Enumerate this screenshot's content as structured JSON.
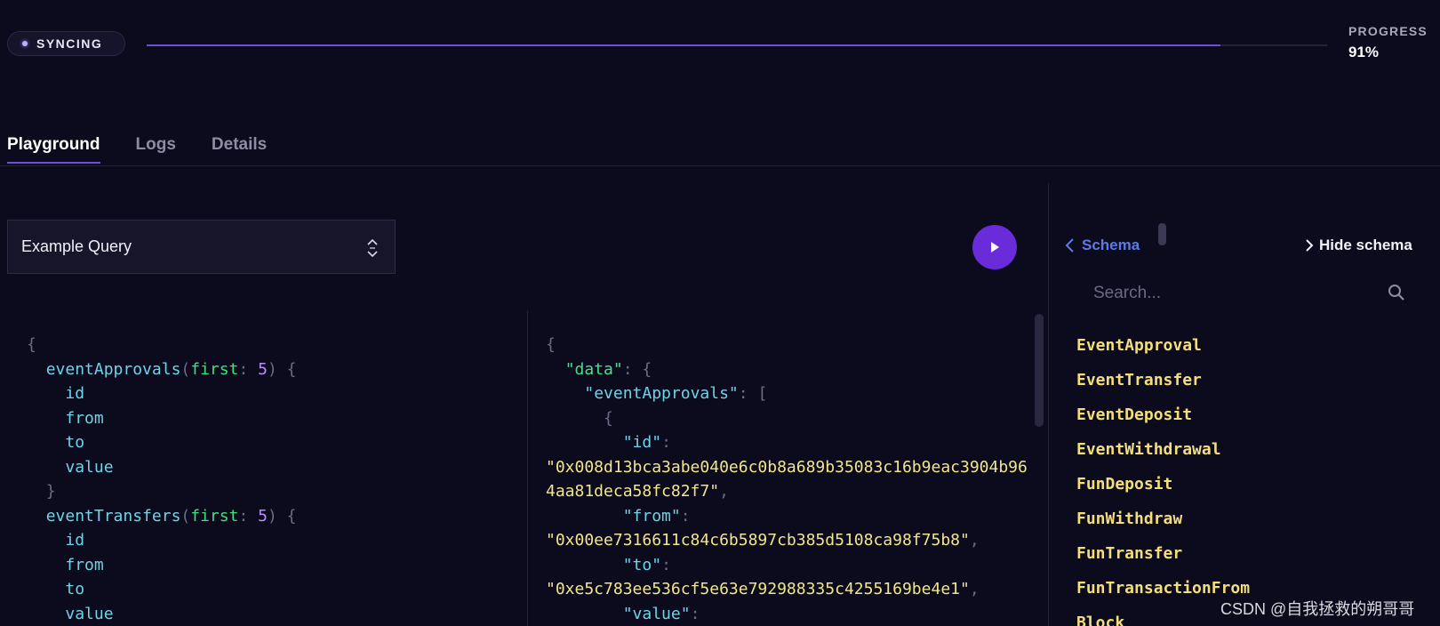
{
  "sync": {
    "status": "SYNCING",
    "progress_title": "PROGRESS",
    "progress_value": "91%",
    "progress_fraction": 0.91
  },
  "tabs": [
    "Playground",
    "Logs",
    "Details"
  ],
  "active_tab": "Playground",
  "query_select": {
    "selected": "Example Query"
  },
  "query_code": {
    "lines": [
      [
        "{"
      ],
      [
        "eventApprovals",
        "(",
        "first",
        ": ",
        "5",
        ") {"
      ],
      [
        "id"
      ],
      [
        "from"
      ],
      [
        "to"
      ],
      [
        "value"
      ],
      [
        "}"
      ],
      [
        "eventTransfers",
        "(",
        "first",
        ": ",
        "5",
        ") {"
      ],
      [
        "id"
      ],
      [
        "from"
      ],
      [
        "to"
      ],
      [
        "value"
      ]
    ]
  },
  "result_code": {
    "brace_open": "{",
    "data_key": "\"data\"",
    "event_approvals_key": "\"eventApprovals\"",
    "array_open": "[",
    "object_open": "{",
    "id_key": "\"id\"",
    "id_value_1": "\"0x008d13bca3abe040e6c0b8a689b35083c16b9eac3904b96",
    "id_value_2": "4aa81deca58fc82f7\"",
    "from_key": "\"from\"",
    "from_value": "\"0x00ee7316611c84c6b5897cb385d5108ca98f75b8\"",
    "to_key": "\"to\"",
    "to_value": "\"0xe5c783ee536cf5e63e792988335c4255169be4e1\"",
    "value_key": "\"value\""
  },
  "schema": {
    "back_label": "Schema",
    "hide_label": "Hide schema",
    "search_placeholder": "Search...",
    "types": [
      "EventApproval",
      "EventTransfer",
      "EventDeposit",
      "EventWithdrawal",
      "FunDeposit",
      "FunWithdraw",
      "FunTransfer",
      "FunTransactionFrom",
      "Block"
    ]
  },
  "watermark": "CSDN @自我拯救的朔哥哥",
  "colors": {
    "accent": "#6d4fd8",
    "run_button": "#6a2bd8",
    "schema_type": "#f3de7a",
    "link": "#5c7be6"
  }
}
